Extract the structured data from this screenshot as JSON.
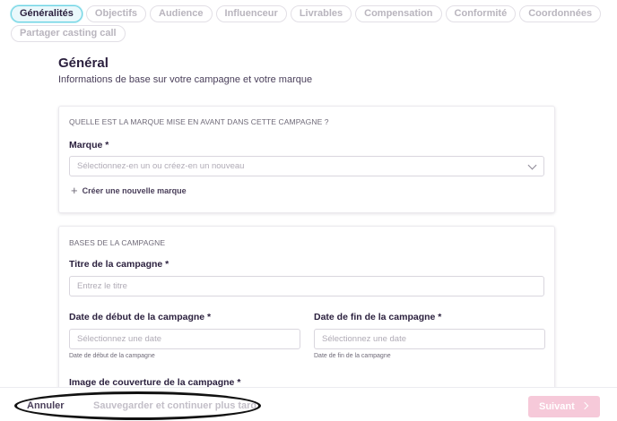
{
  "tabs": [
    {
      "label": "Généralités",
      "active": true
    },
    {
      "label": "Objectifs"
    },
    {
      "label": "Audience"
    },
    {
      "label": "Influenceur"
    },
    {
      "label": "Livrables"
    },
    {
      "label": "Compensation"
    },
    {
      "label": "Conformité"
    },
    {
      "label": "Coordonnées"
    },
    {
      "label": "Partager casting call"
    }
  ],
  "section": {
    "title": "Général",
    "subtitle": "Informations de base sur votre campagne et votre marque"
  },
  "brand_card": {
    "caption": "QUELLE EST LA MARQUE MISE EN AVANT DANS CETTE CAMPAGNE ?",
    "brand_label": "Marque *",
    "brand_placeholder": "Sélectionnez-en un ou créez-en un nouveau",
    "create_link": "Créer une nouvelle marque"
  },
  "campaign_card": {
    "caption": "BASES DE LA CAMPAGNE",
    "title_label": "Titre de la campagne *",
    "title_placeholder": "Entrez le titre",
    "start_label": "Date de début de la campagne *",
    "start_placeholder": "Sélectionnez une date",
    "start_hint": "Date de début de la campagne",
    "end_label": "Date de fin de la campagne *",
    "end_placeholder": "Sélectionnez une date",
    "end_hint": "Date de fin de la campagne",
    "cover_label": "Image de couverture de la campagne *"
  },
  "footer": {
    "cancel": "Annuler",
    "save_later": "Sauvegarder et continuer plus tard",
    "next": "Suivant"
  },
  "colors": {
    "active_tab_border": "#6fd3e3",
    "next_button": "#f6c9d9",
    "text_primary": "#2a1f3d"
  }
}
